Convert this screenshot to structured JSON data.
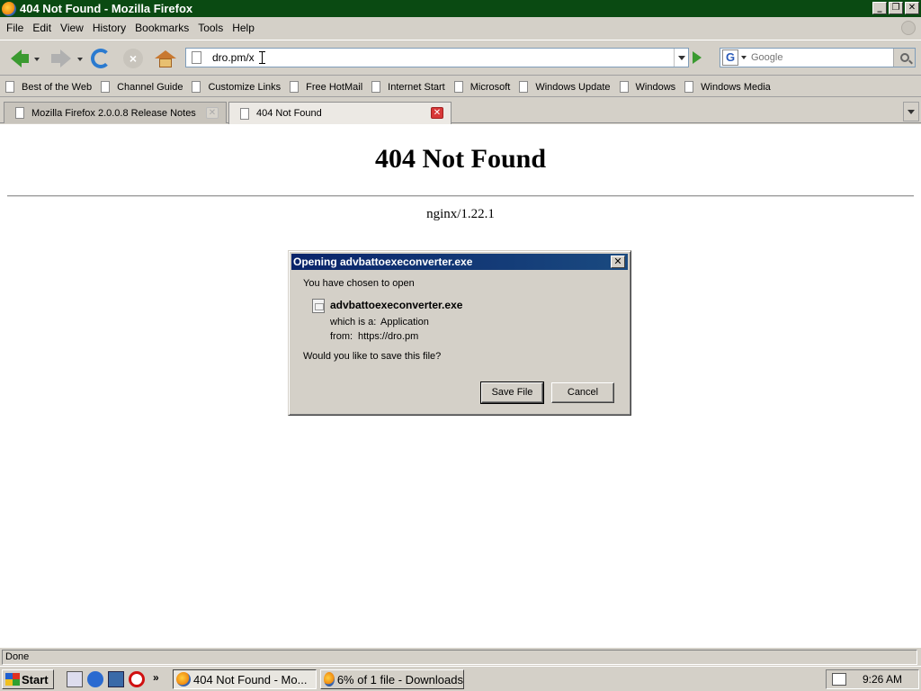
{
  "window": {
    "title": "404 Not Found - Mozilla Firefox",
    "btn_min": "_",
    "btn_max": "❐",
    "btn_close": "✕"
  },
  "menu": [
    "File",
    "Edit",
    "View",
    "History",
    "Bookmarks",
    "Tools",
    "Help"
  ],
  "navbar": {
    "url": "dro.pm/x",
    "search_placeholder": "Google",
    "search_engine_letter": "G"
  },
  "bookmarks": [
    "Best of the Web",
    "Channel Guide",
    "Customize Links",
    "Free HotMail",
    "Internet Start",
    "Microsoft",
    "Windows Update",
    "Windows",
    "Windows Media"
  ],
  "tabs": [
    {
      "label": "Mozilla Firefox 2.0.0.8 Release Notes",
      "close": "✕"
    },
    {
      "label": "404 Not Found",
      "close": "✕"
    }
  ],
  "page": {
    "heading": "404 Not Found",
    "server": "nginx/1.22.1"
  },
  "dialog": {
    "title": "Opening advbattoexeconverter.exe",
    "close": "✕",
    "intro": "You have chosen to open",
    "filename": "advbattoexeconverter.exe",
    "type_label": "which is a:",
    "type_value": "Application",
    "from_label": "from:",
    "from_value": "https://dro.pm",
    "question": "Would you like to save this file?",
    "save_label": "Save File",
    "cancel_label": "Cancel"
  },
  "status": {
    "text": "Done"
  },
  "taskbar": {
    "start": "Start",
    "chevron": "»",
    "items": [
      "404 Not Found - Mo...",
      "6% of 1 file - Downloads"
    ],
    "clock": "9:26 AM"
  },
  "colors": {
    "titlebar": "#0a4a12",
    "dialog_title": "#0a246a",
    "go_arrow": "#3a9a30"
  }
}
